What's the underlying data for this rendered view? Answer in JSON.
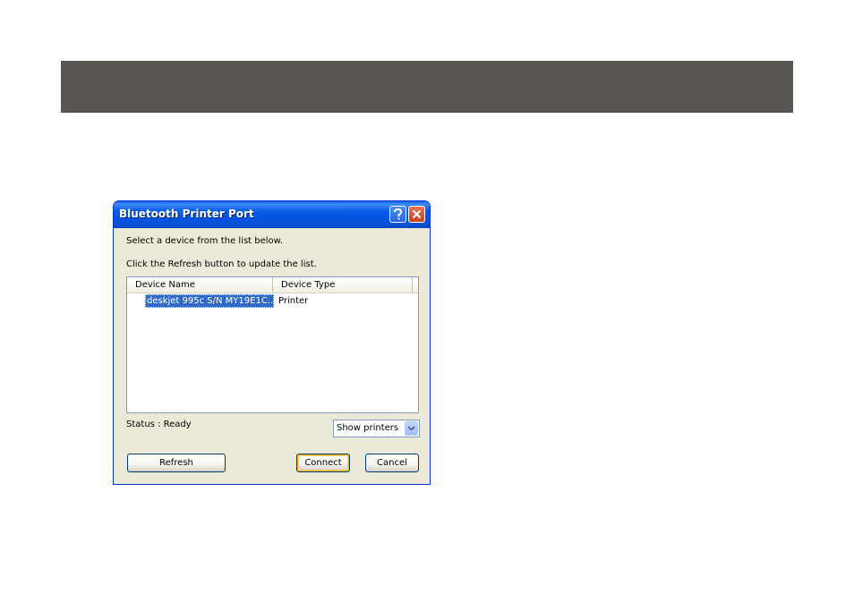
{
  "dialog": {
    "title": "Bluetooth Printer Port",
    "instruction_1": "Select a device from the list below.",
    "instruction_2": "Click the Refresh button to update the list."
  },
  "title_buttons": {
    "help_icon": "question-mark",
    "close_icon": "x-mark",
    "help_color": "#2365de",
    "close_color": "#c8411f"
  },
  "device_list": {
    "columns": [
      "Device Name",
      "Device Type"
    ],
    "rows": [
      {
        "name": "deskjet 995c S/N MY19E1C...",
        "type": "Printer",
        "selected": true
      }
    ],
    "selection_color": "#316ac5"
  },
  "status": {
    "text": "Status : Ready"
  },
  "filter": {
    "selected": "Show printers"
  },
  "buttons": {
    "refresh": "Refresh",
    "connect": "Connect",
    "cancel": "Cancel"
  },
  "colors": {
    "header_band": "#595652",
    "titlebar": "#0054e3",
    "dialog_face": "#ece9d8"
  }
}
